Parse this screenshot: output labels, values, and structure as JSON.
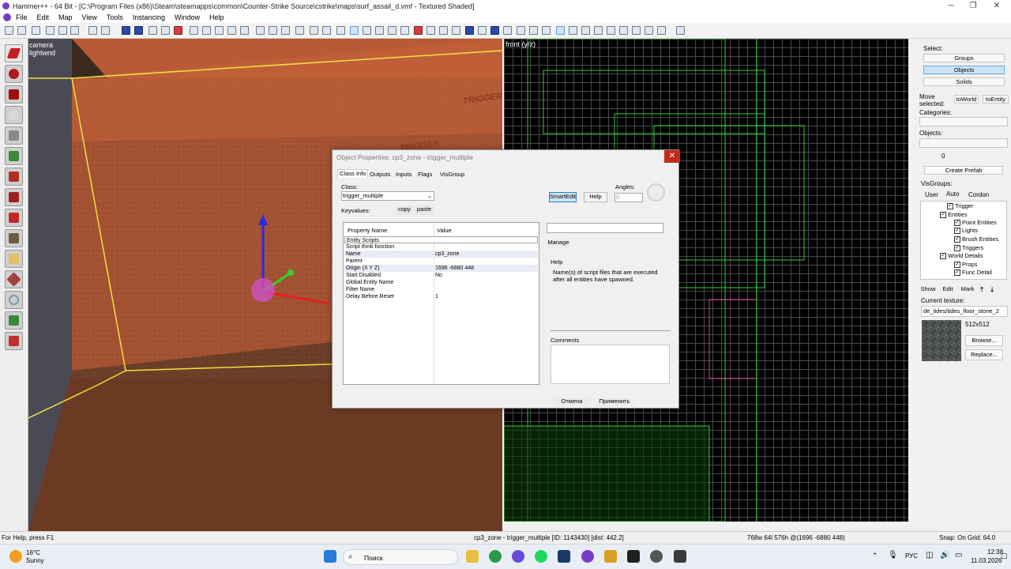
{
  "window": {
    "title": "Hammer++ - 64 Bit - [C:\\Program Files (x86)\\Steam\\steamapps\\common\\Counter-Strike Source\\cstrike\\maps\\surf_assail_d.vmf - Textured Shaded]",
    "minimize": "─",
    "maximize": "❐",
    "close": "✕"
  },
  "menu": [
    "File",
    "Edit",
    "Map",
    "View",
    "Tools",
    "Instancing",
    "Window",
    "Help"
  ],
  "view3d": {
    "label_camera": "camera",
    "label_mode": "lightwnd",
    "texture_text": "TRIGGER"
  },
  "view2d": {
    "label": "front (y/z)"
  },
  "dialog": {
    "title": "Object Properties: cp3_zone - trigger_multiple",
    "close": "✕",
    "tabs": [
      "Class Info",
      "Outputs",
      "Inputs",
      "Flags",
      "VisGroup"
    ],
    "class_label": "Class:",
    "class_value": "trigger_multiple",
    "keyvalues_label": "Keyvalues:",
    "copy": "copy",
    "paste": "paste",
    "smartedit": "SmartEdit",
    "help_btn": "Help",
    "angles_label": "Angles:",
    "angles_value": "0",
    "header_property": "Property Name",
    "header_value": "Value",
    "properties": [
      {
        "key": "Entity Scripts",
        "value": ""
      },
      {
        "key": "Script think function",
        "value": ""
      },
      {
        "key": "Name",
        "value": "cp3_zone"
      },
      {
        "key": "Parent",
        "value": ""
      },
      {
        "key": "Origin (X Y Z)",
        "value": "1696 -6880 448"
      },
      {
        "key": "Start Disabled",
        "value": "No"
      },
      {
        "key": "Global Entity Name",
        "value": ""
      },
      {
        "key": "Filter Name",
        "value": ""
      },
      {
        "key": "Delay Before Reset",
        "value": "1"
      }
    ],
    "manage": "Manage",
    "help_label": "Help",
    "help_text": "Name(s) of script files that are executed after all entities have spawned.",
    "comments_label": "Comments",
    "cancel": "Отмена",
    "apply": "Применить"
  },
  "rightpanel": {
    "select_label": "Select:",
    "groups": "Groups",
    "objects": "Objects",
    "solids": "Solids",
    "move_selected": "Move selected:",
    "toworld": "toWorld",
    "toentity": "toEntity",
    "categories": "Categories:",
    "objects_label": "Objects:",
    "spin_value": "0",
    "create_prefab": "Create Prefab",
    "visgroups": "VisGroups:",
    "vg_tabs": [
      "User",
      "Auto",
      "Cordon"
    ],
    "tree": [
      {
        "label": "Trigger",
        "indent": 0
      },
      {
        "label": "Entities",
        "indent": 0
      },
      {
        "label": "Point Entities",
        "indent": 1
      },
      {
        "label": "Lights",
        "indent": 1
      },
      {
        "label": "Brush Entities",
        "indent": 1
      },
      {
        "label": "Triggers",
        "indent": 1
      },
      {
        "label": "World Details",
        "indent": 0
      },
      {
        "label": "Props",
        "indent": 1
      },
      {
        "label": "Func Detail",
        "indent": 1
      }
    ],
    "show": "Show",
    "edit": "Edit",
    "mark": "Mark",
    "current_texture": "Current texture:",
    "texture_name": "de_tides/tides_floor_stone_2",
    "texture_size": "512x512",
    "browse": "Browse...",
    "replace": "Replace..."
  },
  "status": {
    "help": "For Help, press F1",
    "selection": "cp3_zone - trigger_multiple [ID: 1143430] [dist: 442.2]",
    "coords": "768w 64l 576h @(1696 -6880 448)",
    "snap": "Snap: On Grid: 64.0"
  },
  "taskbar": {
    "temp": "16°C",
    "weather": "Sunny",
    "search": "Поиск",
    "lang": "РУС",
    "time": "12:38",
    "date": "11.03.2026"
  }
}
